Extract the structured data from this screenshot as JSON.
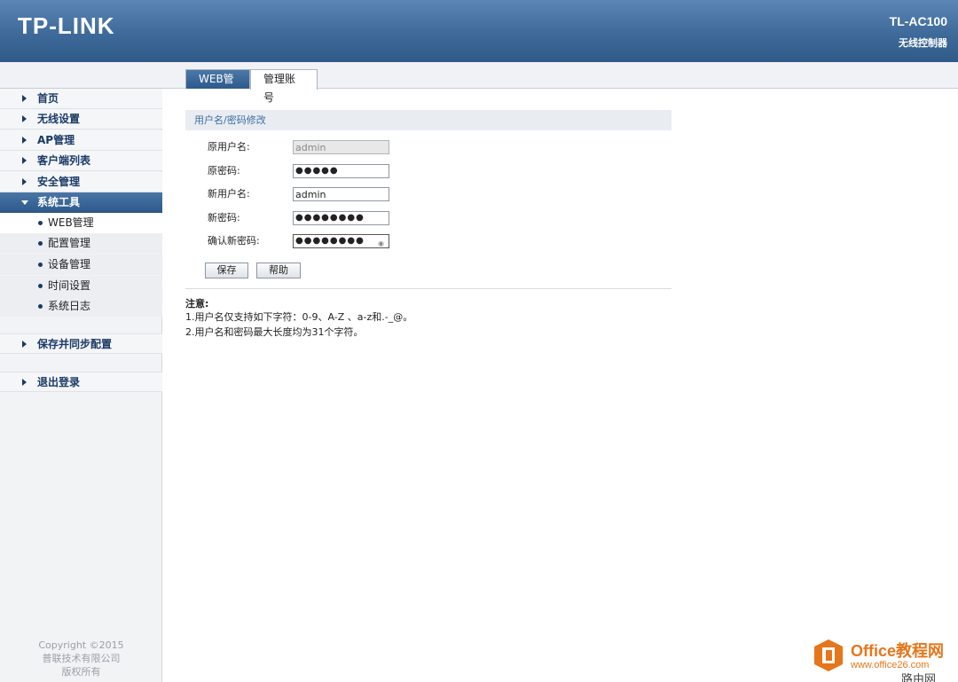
{
  "header": {
    "logo": "TP-LINK",
    "model": "TL-AC100",
    "model_sub": "无线控制器"
  },
  "tabs": [
    {
      "label": "WEB管理",
      "active": false
    },
    {
      "label": "管理账号",
      "active": true
    }
  ],
  "sidebar": {
    "items": [
      {
        "label": "首页"
      },
      {
        "label": "无线设置"
      },
      {
        "label": "AP管理"
      },
      {
        "label": "客户端列表"
      },
      {
        "label": "安全管理"
      },
      {
        "label": "系统工具",
        "expanded": true
      }
    ],
    "sub_items": [
      {
        "label": "WEB管理",
        "current": true
      },
      {
        "label": "配置管理"
      },
      {
        "label": "设备管理"
      },
      {
        "label": "时间设置"
      },
      {
        "label": "系统日志"
      }
    ],
    "save_sync": "保存并同步配置",
    "logout": "退出登录",
    "copyright": [
      "Copyright ©2015",
      "普联技术有限公司",
      "版权所有"
    ]
  },
  "form": {
    "section_title": "用户名/密码修改",
    "fields": [
      {
        "label": "原用户名:",
        "value": "admin",
        "disabled": true
      },
      {
        "label": "原密码:",
        "value": "●●●●●"
      },
      {
        "label": "新用户名:",
        "value": "admin"
      },
      {
        "label": "新密码:",
        "value": "●●●●●●●●"
      },
      {
        "label": "确认新密码:",
        "value": "●●●●●●●●"
      }
    ],
    "save_button": "保存",
    "help_button": "帮助"
  },
  "notes": {
    "title": "注意:",
    "lines": [
      "1.用户名仅支持如下字符：0-9、A-Z 、a-z和.-_@。",
      "2.用户名和密码最大长度均为31个字符。"
    ]
  },
  "watermark": {
    "title": "Office教程网",
    "url": "www.office26.com",
    "corner": "路由网"
  },
  "colors": {
    "header": "#3e6a9a",
    "active_nav": "#2d5a8b",
    "watermark": "#e6761b"
  }
}
